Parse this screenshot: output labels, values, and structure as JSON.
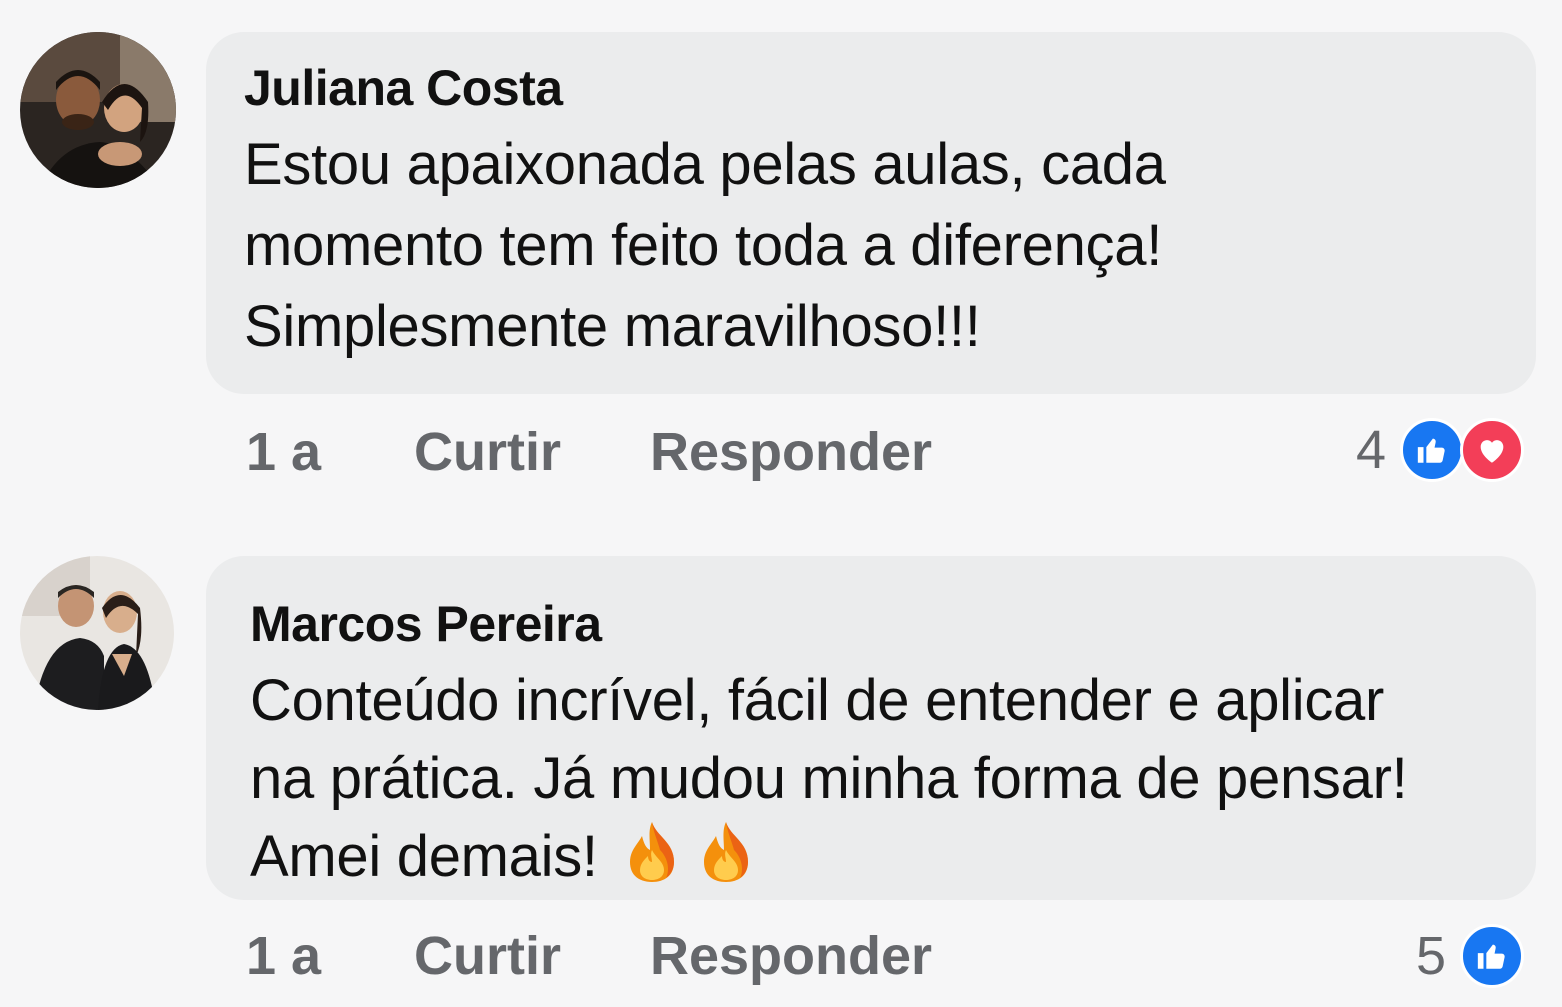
{
  "comments": [
    {
      "author": "Juliana Costa",
      "text": "Estou apaixonada pelas aulas, cada\nmomento tem feito toda a diferença!\nSimplesmente maravilhoso!!!",
      "time": "1 a",
      "like_label": "Curtir",
      "reply_label": "Responder",
      "reaction_count": "4",
      "reactions": [
        "like-icon",
        "love-icon"
      ]
    },
    {
      "author": "Marcos Pereira",
      "text": "Conteúdo incrível, fácil de entender e aplicar\nna prática. Já mudou minha forma de pensar!\nAmei demais!",
      "emoji": [
        "fire-icon",
        "fire-icon"
      ],
      "time": "1 a",
      "like_label": "Curtir",
      "reply_label": "Responder",
      "reaction_count": "5",
      "reactions": [
        "like-icon"
      ]
    }
  ],
  "colors": {
    "background": "#f6f6f7",
    "bubble": "#ebeced",
    "action_text": "#65676b",
    "like_blue": "#1877f2",
    "love_red": "#f33e58"
  }
}
